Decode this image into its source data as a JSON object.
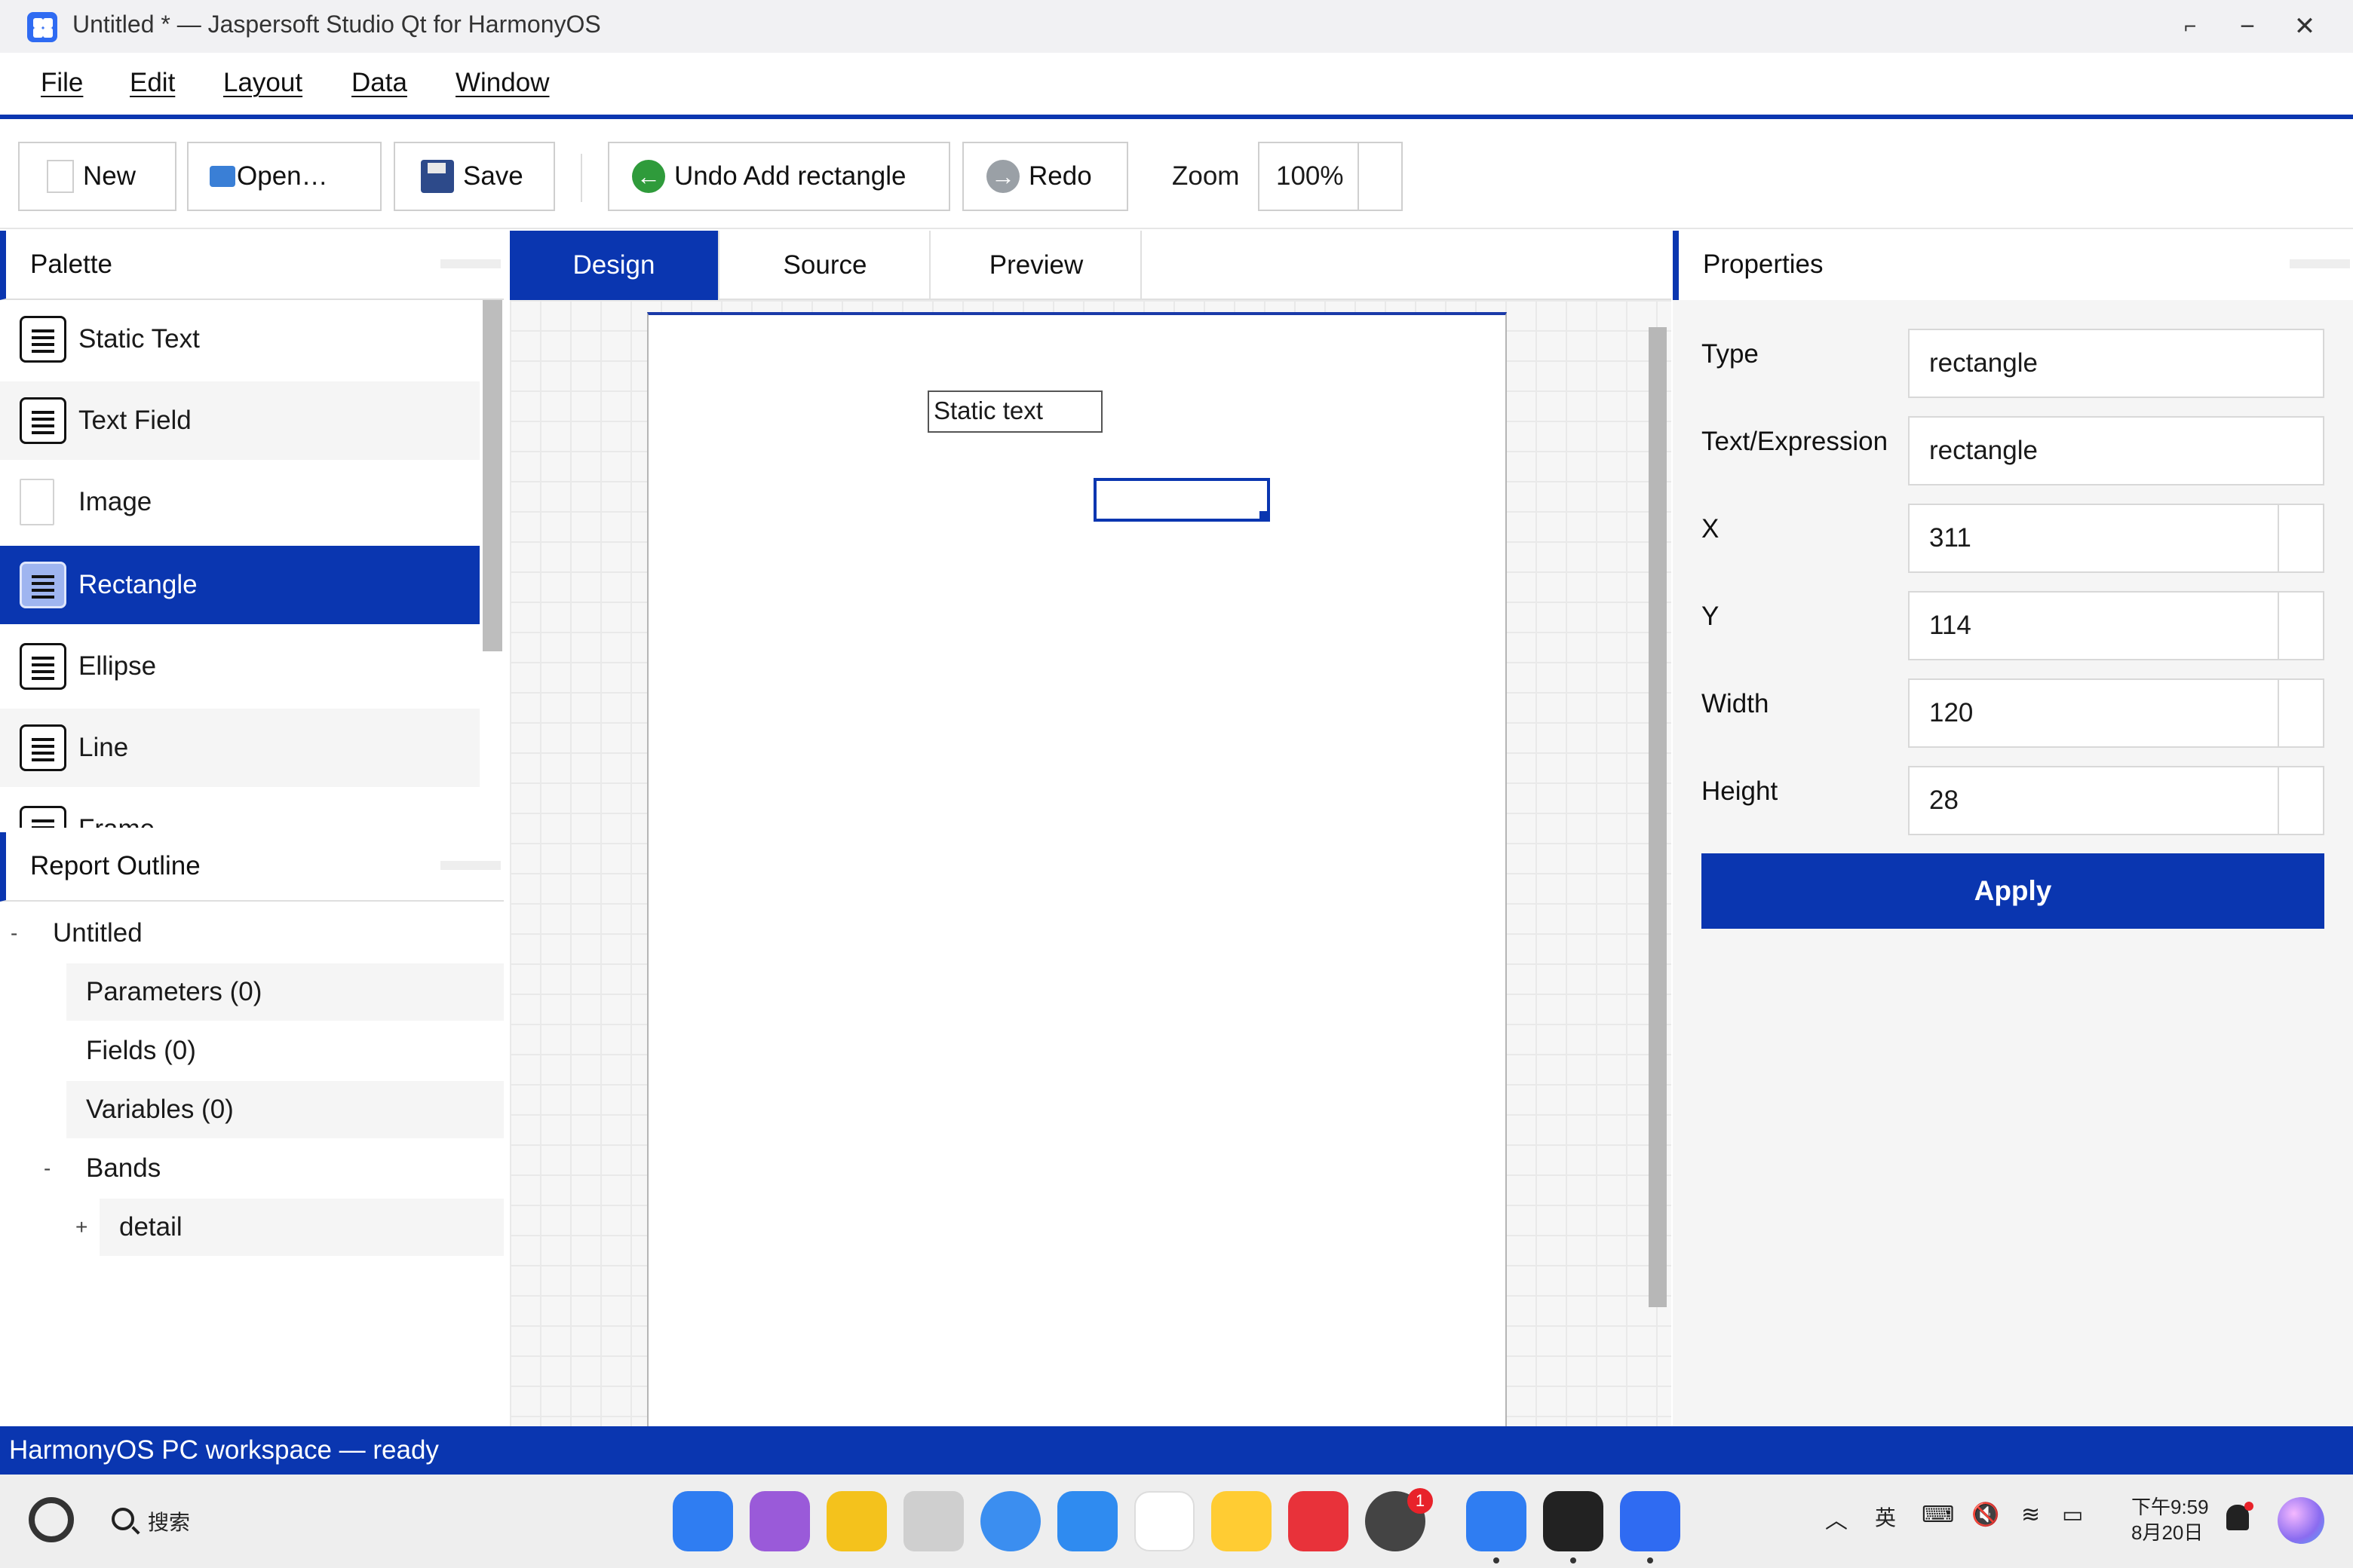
{
  "window": {
    "title": "Untitled * — Jaspersoft Studio Qt for HarmonyOS",
    "controls": [
      "restore-icon",
      "minimize-icon",
      "close-icon"
    ]
  },
  "menu": [
    "File",
    "Edit",
    "Layout",
    "Data",
    "Window"
  ],
  "toolbar": {
    "new_label": "New",
    "open_label": "Open…",
    "save_label": "Save",
    "undo_label": "Undo Add rectangle",
    "redo_label": "Redo",
    "zoom_label": "Zoom",
    "zoom_value": "100%"
  },
  "palette": {
    "title": "Palette",
    "items": [
      {
        "label": "Static Text",
        "icon": "text-icon"
      },
      {
        "label": "Text Field",
        "icon": "text-icon"
      },
      {
        "label": "Image",
        "icon": "image-icon"
      },
      {
        "label": "Rectangle",
        "icon": "text-icon",
        "selected": true
      },
      {
        "label": "Ellipse",
        "icon": "text-icon"
      },
      {
        "label": "Line",
        "icon": "text-icon"
      },
      {
        "label": "Frame",
        "icon": "text-icon"
      }
    ]
  },
  "outline": {
    "title": "Report Outline",
    "root": "Untitled",
    "root_toggle": "-",
    "parameters": "Parameters (0)",
    "fields": "Fields (0)",
    "variables": "Variables (0)",
    "bands": "Bands",
    "bands_toggle": "-",
    "detail": "detail",
    "detail_toggle": "+"
  },
  "tabs": [
    "Design",
    "Source",
    "Preview"
  ],
  "active_tab": "Design",
  "canvas": {
    "static_text": "Static text"
  },
  "properties": {
    "title": "Properties",
    "type_label": "Type",
    "type_value": "rectangle",
    "expr_label": "Text/Expression",
    "expr_value": "rectangle",
    "x_label": "X",
    "x_value": "311",
    "y_label": "Y",
    "y_value": "114",
    "width_label": "Width",
    "width_value": "120",
    "height_label": "Height",
    "height_value": "28",
    "apply_label": "Apply"
  },
  "status": "HarmonyOS PC workspace — ready",
  "taskbar": {
    "search_label": "搜索",
    "badge_count": "1",
    "ime_label": "英",
    "time": "下午9:59",
    "date": "8月20日"
  },
  "colors": {
    "accent": "#0a36b0",
    "selection": "#0a36b0",
    "panel_bg": "#f5f5f5"
  }
}
